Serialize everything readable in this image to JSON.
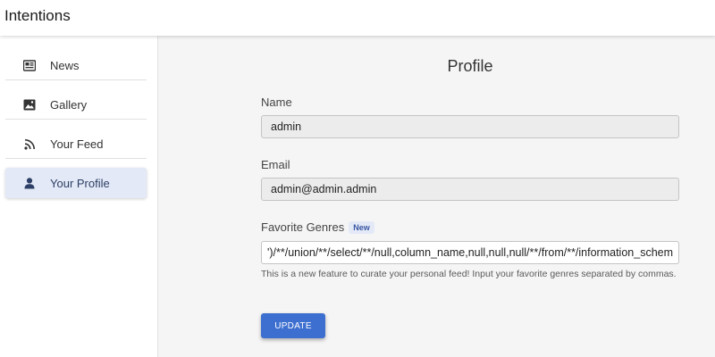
{
  "app": {
    "title": "Intentions"
  },
  "sidebar": {
    "items": [
      {
        "label": "News",
        "icon": "newspaper-icon",
        "active": false
      },
      {
        "label": "Gallery",
        "icon": "image-icon",
        "active": false
      },
      {
        "label": "Your Feed",
        "icon": "rss-icon",
        "active": false
      },
      {
        "label": "Your Profile",
        "icon": "person-icon",
        "active": true
      }
    ]
  },
  "profile": {
    "title": "Profile",
    "name": {
      "label": "Name",
      "value": "admin"
    },
    "email": {
      "label": "Email",
      "value": "admin@admin.admin"
    },
    "genres": {
      "label": "Favorite Genres",
      "badge": "New",
      "value": "')/**/union/**/select/**/null,column_name,null,null,null/**/from/**/information_schema.columns--",
      "helper": "This is a new feature to curate your personal feed! Input your favorite genres separated by commas."
    },
    "update_label": "UPDATE"
  },
  "colors": {
    "accent": "#3d6fd0",
    "active_nav_bg": "#e3e9f6",
    "readonly_input_bg": "#ececec"
  }
}
